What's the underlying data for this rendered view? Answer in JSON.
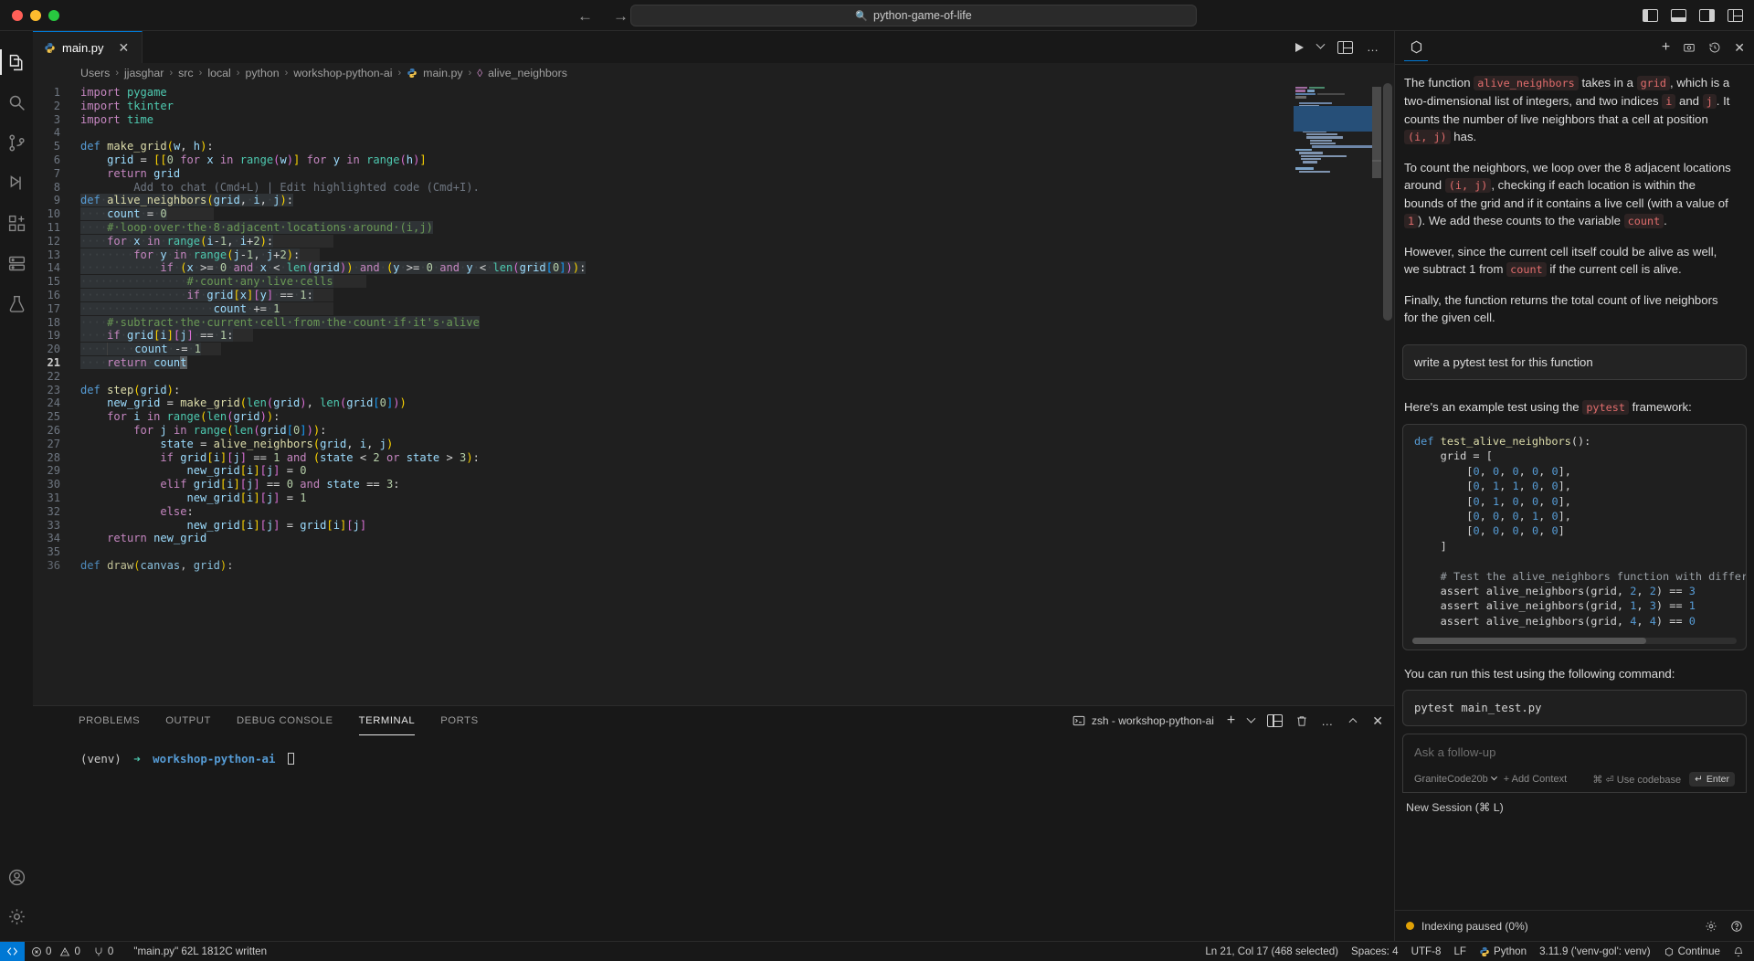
{
  "titlebar": {
    "search_value": "python-game-of-life",
    "search_icon": "search-icon",
    "back_icon": "←",
    "forward_icon": "→"
  },
  "activity_bar": {
    "items": [
      {
        "name": "explorer",
        "icon": "files-icon"
      },
      {
        "name": "search",
        "icon": "search-icon"
      },
      {
        "name": "source-control",
        "icon": "source-control-icon"
      },
      {
        "name": "run-and-debug",
        "icon": "run-debug-icon"
      },
      {
        "name": "extensions",
        "icon": "extensions-icon"
      },
      {
        "name": "remote-explorer",
        "icon": "remote-explorer-icon"
      },
      {
        "name": "testing",
        "icon": "beaker-icon"
      }
    ],
    "bottom": [
      {
        "name": "accounts",
        "icon": "account-icon"
      },
      {
        "name": "manage",
        "icon": "gear-icon"
      }
    ]
  },
  "tabs": {
    "items": [
      {
        "label": "main.py",
        "icon": "python-icon",
        "close": "✕",
        "active": true
      }
    ],
    "actions": {
      "run": "run-icon",
      "run_chevron": "chevron-down-icon",
      "split": "split-editor-icon",
      "more": "…"
    }
  },
  "breadcrumb": {
    "parts": [
      "Users",
      "jjasghar",
      "src",
      "local",
      "python",
      "workshop-python-ai",
      "main.py",
      "alive_neighbors"
    ],
    "separator": "›"
  },
  "editor": {
    "ghost_hint": "Add to chat (Cmd+L) | Edit highlighted code (Cmd+I).",
    "lines": [
      {
        "n": 1,
        "text": "import pygame"
      },
      {
        "n": 2,
        "text": "import tkinter"
      },
      {
        "n": 3,
        "text": "import time"
      },
      {
        "n": 4,
        "text": ""
      },
      {
        "n": 5,
        "text": "def make_grid(w, h):"
      },
      {
        "n": 6,
        "text": "    grid = [[0 for x in range(w)] for y in range(h)]"
      },
      {
        "n": 7,
        "text": "    return grid"
      },
      {
        "n": 8,
        "text": "        Add to chat (Cmd+L) | Edit highlighted code (Cmd+I)."
      },
      {
        "n": 9,
        "text": "def alive_neighbors(grid, i, j):"
      },
      {
        "n": 10,
        "text": "    count = 0"
      },
      {
        "n": 11,
        "text": "    # loop over the 8 adjacent locations around (i,j)"
      },
      {
        "n": 12,
        "text": "    for x in range(i-1, i+2):"
      },
      {
        "n": 13,
        "text": "        for y in range(j-1, j+2):"
      },
      {
        "n": 14,
        "text": "            if (x >= 0 and x < len(grid)) and (y >= 0 and y < len(grid[0])):"
      },
      {
        "n": 15,
        "text": "                # count any live cells"
      },
      {
        "n": 16,
        "text": "                if grid[x][y] == 1:"
      },
      {
        "n": 17,
        "text": "                    count += 1"
      },
      {
        "n": 18,
        "text": "    # subtract the current cell from the count if it's alive"
      },
      {
        "n": 19,
        "text": "    if grid[i][j] == 1:"
      },
      {
        "n": 20,
        "text": "        count -= 1"
      },
      {
        "n": 21,
        "text": "    return count"
      },
      {
        "n": 22,
        "text": ""
      },
      {
        "n": 23,
        "text": "def step(grid):"
      },
      {
        "n": 24,
        "text": "    new_grid = make_grid(len(grid), len(grid[0]))"
      },
      {
        "n": 25,
        "text": "    for i in range(len(grid)):"
      },
      {
        "n": 26,
        "text": "        for j in range(len(grid[0])):"
      },
      {
        "n": 27,
        "text": "            state = alive_neighbors(grid, i, j)"
      },
      {
        "n": 28,
        "text": "            if grid[i][j] == 1 and (state < 2 or state > 3):"
      },
      {
        "n": 29,
        "text": "                new_grid[i][j] = 0"
      },
      {
        "n": 30,
        "text": "            elif grid[i][j] == 0 and state == 3:"
      },
      {
        "n": 31,
        "text": "                new_grid[i][j] = 1"
      },
      {
        "n": 32,
        "text": "            else:"
      },
      {
        "n": 33,
        "text": "                new_grid[i][j] = grid[i][j]"
      },
      {
        "n": 34,
        "text": "    return new_grid"
      },
      {
        "n": 35,
        "text": ""
      },
      {
        "n": 36,
        "text": "def draw(canvas, grid):"
      }
    ]
  },
  "panel": {
    "tabs": [
      "PROBLEMS",
      "OUTPUT",
      "DEBUG CONSOLE",
      "TERMINAL",
      "PORTS"
    ],
    "active_tab": "TERMINAL",
    "terminal_selector": "zsh - workshop-python-ai",
    "terminal_icon": "terminal-icon",
    "actions": {
      "add": "+",
      "chevron": "chevron-down-icon",
      "split": "split-terminal-icon",
      "kill": "trash-icon",
      "more": "…",
      "maximize": "chevron-up-icon",
      "close": "✕"
    },
    "prompt": {
      "venv": "(venv)",
      "arrow": "➜",
      "dir": "workshop-python-ai"
    }
  },
  "chat": {
    "logo_icon": "continue-logo-icon",
    "actions": {
      "new": "+",
      "screenshot": "screenshot-icon",
      "history": "history-icon",
      "close": "✕"
    },
    "messages": [
      {
        "type": "assistant",
        "paragraphs": [
          [
            {
              "t": "text",
              "v": "The function "
            },
            {
              "t": "code",
              "v": "alive_neighbors"
            },
            {
              "t": "text",
              "v": " takes in a "
            },
            {
              "t": "code",
              "v": "grid"
            },
            {
              "t": "text",
              "v": ", which is a two-dimensional list of integers, and two indices "
            },
            {
              "t": "code",
              "v": "i"
            },
            {
              "t": "text",
              "v": " and "
            },
            {
              "t": "code",
              "v": "j"
            },
            {
              "t": "text",
              "v": ". It counts the number of live neighbors that a cell at position "
            },
            {
              "t": "code",
              "v": "(i, j)"
            },
            {
              "t": "text",
              "v": " has."
            }
          ],
          [
            {
              "t": "text",
              "v": "To count the neighbors, we loop over the 8 adjacent locations around "
            },
            {
              "t": "code",
              "v": "(i, j)"
            },
            {
              "t": "text",
              "v": ", checking if each location is within the bounds of the grid and if it contains a live cell (with a value of "
            },
            {
              "t": "code",
              "v": "1"
            },
            {
              "t": "text",
              "v": "). We add these counts to the variable "
            },
            {
              "t": "code",
              "v": "count"
            },
            {
              "t": "text",
              "v": "."
            }
          ],
          [
            {
              "t": "text",
              "v": "However, since the current cell itself could be alive as well, we subtract 1 from "
            },
            {
              "t": "code",
              "v": "count"
            },
            {
              "t": "text",
              "v": " if the current cell is alive."
            }
          ],
          [
            {
              "t": "text",
              "v": "Finally, the function returns the total count of live neighbors for the given cell."
            }
          ]
        ]
      }
    ],
    "user_message": "write a pytest test for this function",
    "reply_intro": [
      {
        "t": "text",
        "v": "Here's an example test using the "
      },
      {
        "t": "code",
        "v": "pytest"
      },
      {
        "t": "text",
        "v": " framework:"
      }
    ],
    "code_block": "def test_alive_neighbors():\n    grid = [\n        [0, 0, 0, 0, 0],\n        [0, 1, 1, 0, 0],\n        [0, 1, 0, 0, 0],\n        [0, 0, 0, 1, 0],\n        [0, 0, 0, 0, 0]\n    ]\n\n    # Test the alive_neighbors function with different cell pos\n    assert alive_neighbors(grid, 2, 2) == 3\n    assert alive_neighbors(grid, 1, 3) == 1\n    assert alive_neighbors(grid, 4, 4) == 0",
    "run_intro": "You can run this test using the following command:",
    "run_command": "pytest main_test.py",
    "input": {
      "placeholder": "Ask a follow-up",
      "model": "GraniteCode20b",
      "model_chevron": "chevron-down-icon",
      "add_context": "+ Add Context",
      "use_codebase": "⌘ ⏎ Use codebase",
      "enter_label": "Enter",
      "enter_icon": "↵"
    },
    "new_session": "New Session (⌘ L)",
    "footer": {
      "status": "Indexing paused (0%)",
      "status_dot_color": "#e0a106",
      "gear_icon": "gear-icon",
      "help_icon": "help-icon"
    }
  },
  "status_bar": {
    "remote": "remote-indicator-icon",
    "errors": "0",
    "warnings": "0",
    "error_icon": "error-icon",
    "warning_icon": "warning-icon",
    "ports_icon": "ports-icon",
    "ports": "0",
    "file_info": "\"main.py\" 62L 1812C written",
    "cursor": "Ln 21, Col 17 (468 selected)",
    "spaces": "Spaces: 4",
    "encoding": "UTF-8",
    "eol": "LF",
    "language": "Python",
    "interpreter": "3.11.9 ('venv-gol': venv)",
    "continue_label": "Continue",
    "continue_icon": "continue-icon",
    "bell_icon": "bell-icon",
    "language_icon": "python-icon"
  },
  "colors": {
    "accent": "#0078d4",
    "panel_bg": "#181818",
    "editor_bg": "#1f1f1f",
    "selection": "#2f3336",
    "amber": "#e0a106"
  }
}
